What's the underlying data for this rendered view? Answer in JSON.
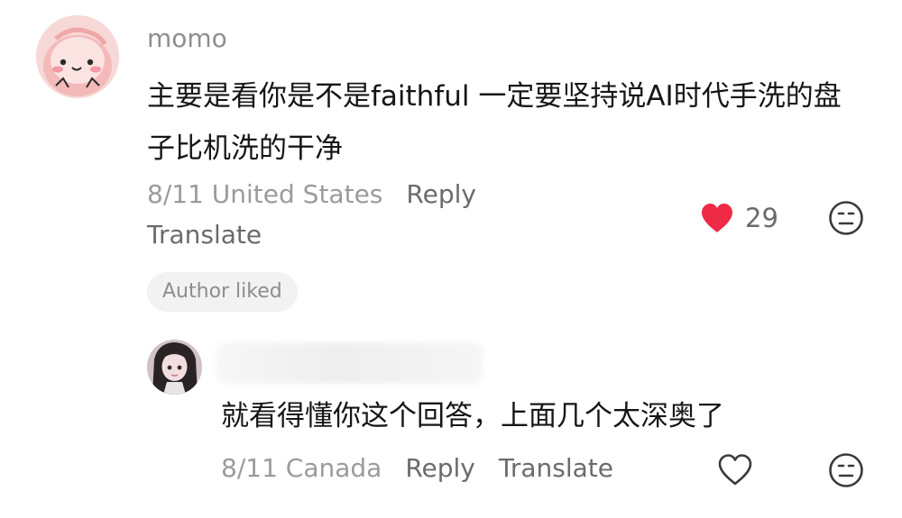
{
  "comment": {
    "username": "momo",
    "text": "主要是看你是不是faithful 一定要坚持说AI时代手洗的盘子比机洗的干净",
    "date_location": "8/11 United States",
    "reply_label": "Reply",
    "translate_label": "Translate",
    "like_count": "29",
    "liked": true,
    "author_liked_label": "Author liked",
    "accent_color": "#ee2a47"
  },
  "reply": {
    "text": "就看得懂你这个回答，上面几个太深奥了",
    "date_location": "8/11 Canada",
    "reply_label": "Reply",
    "translate_label": "Translate",
    "liked": false
  },
  "icons": {
    "like_filled": "heart-filled-icon",
    "like_outline": "heart-outline-icon",
    "reaction": "neutral-face-icon"
  }
}
